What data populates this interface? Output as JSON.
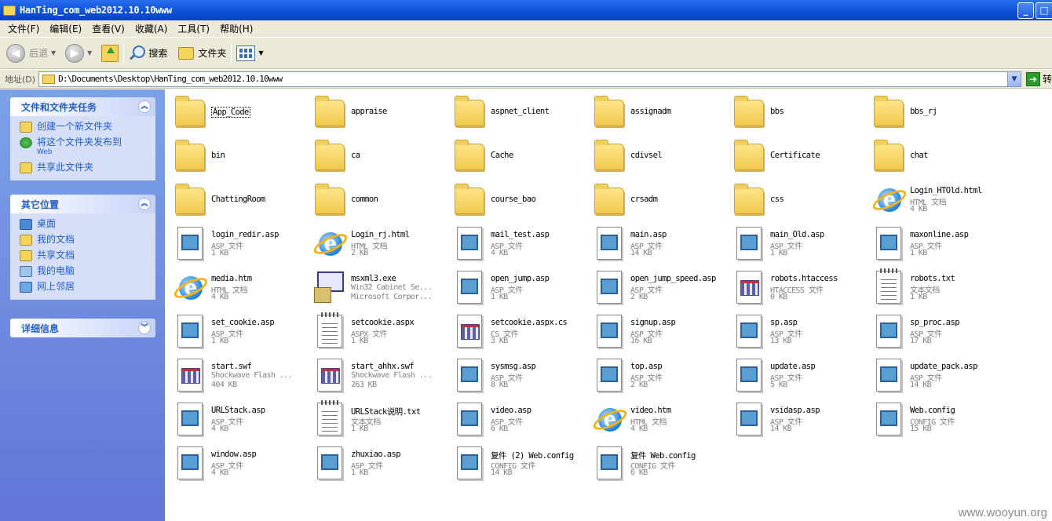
{
  "window": {
    "title": "HanTing_com_web2012.10.10www"
  },
  "menu": [
    "文件(F)",
    "编辑(E)",
    "查看(V)",
    "收藏(A)",
    "工具(T)",
    "帮助(H)"
  ],
  "toolbar": {
    "back": "后退",
    "search": "搜索",
    "folders": "文件夹"
  },
  "address": {
    "label": "地址(D)",
    "path": "D:\\Documents\\Desktop\\HanTing_com_web2012.10.10www",
    "go": "转"
  },
  "tasks": {
    "file_tasks_title": "文件和文件夹任务",
    "file_tasks": [
      {
        "label": "创建一个新文件夹",
        "icon": "new-folder-icon"
      },
      {
        "label": "将这个文件夹发布到",
        "sub": "Web",
        "icon": "publish-web-icon"
      },
      {
        "label": "共享此文件夹",
        "icon": "share-folder-icon"
      }
    ],
    "other_places_title": "其它位置",
    "other_places": [
      {
        "label": "桌面",
        "icon": "desktop-icon"
      },
      {
        "label": "我的文档",
        "icon": "my-documents-icon"
      },
      {
        "label": "共享文档",
        "icon": "shared-documents-icon"
      },
      {
        "label": "我的电脑",
        "icon": "my-computer-icon"
      },
      {
        "label": "网上邻居",
        "icon": "network-places-icon"
      }
    ],
    "details_title": "详细信息"
  },
  "items": [
    {
      "name": "App_Code",
      "kind": "folder",
      "selected": true
    },
    {
      "name": "appraise",
      "kind": "folder"
    },
    {
      "name": "aspnet_client",
      "kind": "folder"
    },
    {
      "name": "assignadm",
      "kind": "folder"
    },
    {
      "name": "bbs",
      "kind": "folder"
    },
    {
      "name": "bbs_rj",
      "kind": "folder"
    },
    {
      "name": "bin",
      "kind": "folder"
    },
    {
      "name": "ca",
      "kind": "folder"
    },
    {
      "name": "Cache",
      "kind": "folder"
    },
    {
      "name": "cdivsel",
      "kind": "folder"
    },
    {
      "name": "Certificate",
      "kind": "folder"
    },
    {
      "name": "chat",
      "kind": "folder"
    },
    {
      "name": "ChattingRoom",
      "kind": "folder"
    },
    {
      "name": "common",
      "kind": "folder"
    },
    {
      "name": "course_bao",
      "kind": "folder"
    },
    {
      "name": "crsadm",
      "kind": "folder"
    },
    {
      "name": "css",
      "kind": "folder"
    },
    {
      "name": "Login_HTOld.html",
      "kind": "ie",
      "type": "HTML 文档",
      "size": "4 KB"
    },
    {
      "name": "login_redir.asp",
      "kind": "asp",
      "type": "ASP 文件",
      "size": "1 KB"
    },
    {
      "name": "Login_rj.html",
      "kind": "ie",
      "type": "HTML 文档",
      "size": "2 KB"
    },
    {
      "name": "mail_test.asp",
      "kind": "asp",
      "type": "ASP 文件",
      "size": "4 KB"
    },
    {
      "name": "main.asp",
      "kind": "asp",
      "type": "ASP 文件",
      "size": "14 KB"
    },
    {
      "name": "main_Old.asp",
      "kind": "asp",
      "type": "ASP 文件",
      "size": "1 KB"
    },
    {
      "name": "maxonline.asp",
      "kind": "asp",
      "type": "ASP 文件",
      "size": "1 KB"
    },
    {
      "name": "media.htm",
      "kind": "ie",
      "type": "HTML 文档",
      "size": "4 KB"
    },
    {
      "name": "msxml3.exe",
      "kind": "setup",
      "type": "Win32 Cabinet Se...",
      "size": "Microsoft Corpor..."
    },
    {
      "name": "open_jump.asp",
      "kind": "asp",
      "type": "ASP 文件",
      "size": "1 KB"
    },
    {
      "name": "open_jump_speed.asp",
      "kind": "asp",
      "type": "ASP 文件",
      "size": "2 KB"
    },
    {
      "name": "robots.htaccess",
      "kind": "generic",
      "type": "HTACCESS 文件",
      "size": "0 KB"
    },
    {
      "name": "robots.txt",
      "kind": "text",
      "type": "文本文档",
      "size": "1 KB"
    },
    {
      "name": "set_cookie.asp",
      "kind": "asp",
      "type": "ASP 文件",
      "size": "1 KB"
    },
    {
      "name": "setcookie.aspx",
      "kind": "text",
      "type": "ASPX 文件",
      "size": "1 KB"
    },
    {
      "name": "setcookie.aspx.cs",
      "kind": "generic",
      "type": "CS 文件",
      "size": "3 KB"
    },
    {
      "name": "signup.asp",
      "kind": "asp",
      "type": "ASP 文件",
      "size": "16 KB"
    },
    {
      "name": "sp.asp",
      "kind": "asp",
      "type": "ASP 文件",
      "size": "13 KB"
    },
    {
      "name": "sp_proc.asp",
      "kind": "asp",
      "type": "ASP 文件",
      "size": "17 KB"
    },
    {
      "name": "start.swf",
      "kind": "generic",
      "type": "Shockwave Flash ...",
      "size": "404 KB"
    },
    {
      "name": "start_ahhx.swf",
      "kind": "generic",
      "type": "Shockwave Flash ...",
      "size": "263 KB"
    },
    {
      "name": "sysmsg.asp",
      "kind": "asp",
      "type": "ASP 文件",
      "size": "8 KB"
    },
    {
      "name": "top.asp",
      "kind": "asp",
      "type": "ASP 文件",
      "size": "2 KB"
    },
    {
      "name": "update.asp",
      "kind": "asp",
      "type": "ASP 文件",
      "size": "5 KB"
    },
    {
      "name": "update_pack.asp",
      "kind": "asp",
      "type": "ASP 文件",
      "size": "14 KB"
    },
    {
      "name": "URLStack.asp",
      "kind": "asp",
      "type": "ASP 文件",
      "size": "4 KB"
    },
    {
      "name": "URLStack说明.txt",
      "kind": "text",
      "type": "文本文档",
      "size": "1 KB"
    },
    {
      "name": "video.asp",
      "kind": "asp",
      "type": "ASP 文件",
      "size": "6 KB"
    },
    {
      "name": "video.htm",
      "kind": "ie",
      "type": "HTML 文档",
      "size": "4 KB"
    },
    {
      "name": "vsidasp.asp",
      "kind": "asp",
      "type": "ASP 文件",
      "size": "14 KB"
    },
    {
      "name": "Web.config",
      "kind": "asp",
      "type": "CONFIG 文件",
      "size": "15 KB"
    },
    {
      "name": "window.asp",
      "kind": "asp",
      "type": "ASP 文件",
      "size": "4 KB"
    },
    {
      "name": "zhuxiao.asp",
      "kind": "asp",
      "type": "ASP 文件",
      "size": "1 KB"
    },
    {
      "name": "复件 (2) Web.config",
      "kind": "asp",
      "type": "CONFIG 文件",
      "size": "14 KB"
    },
    {
      "name": "复件 Web.config",
      "kind": "asp",
      "type": "CONFIG 文件",
      "size": "6 KB"
    }
  ],
  "watermark": "www.wooyun.org"
}
